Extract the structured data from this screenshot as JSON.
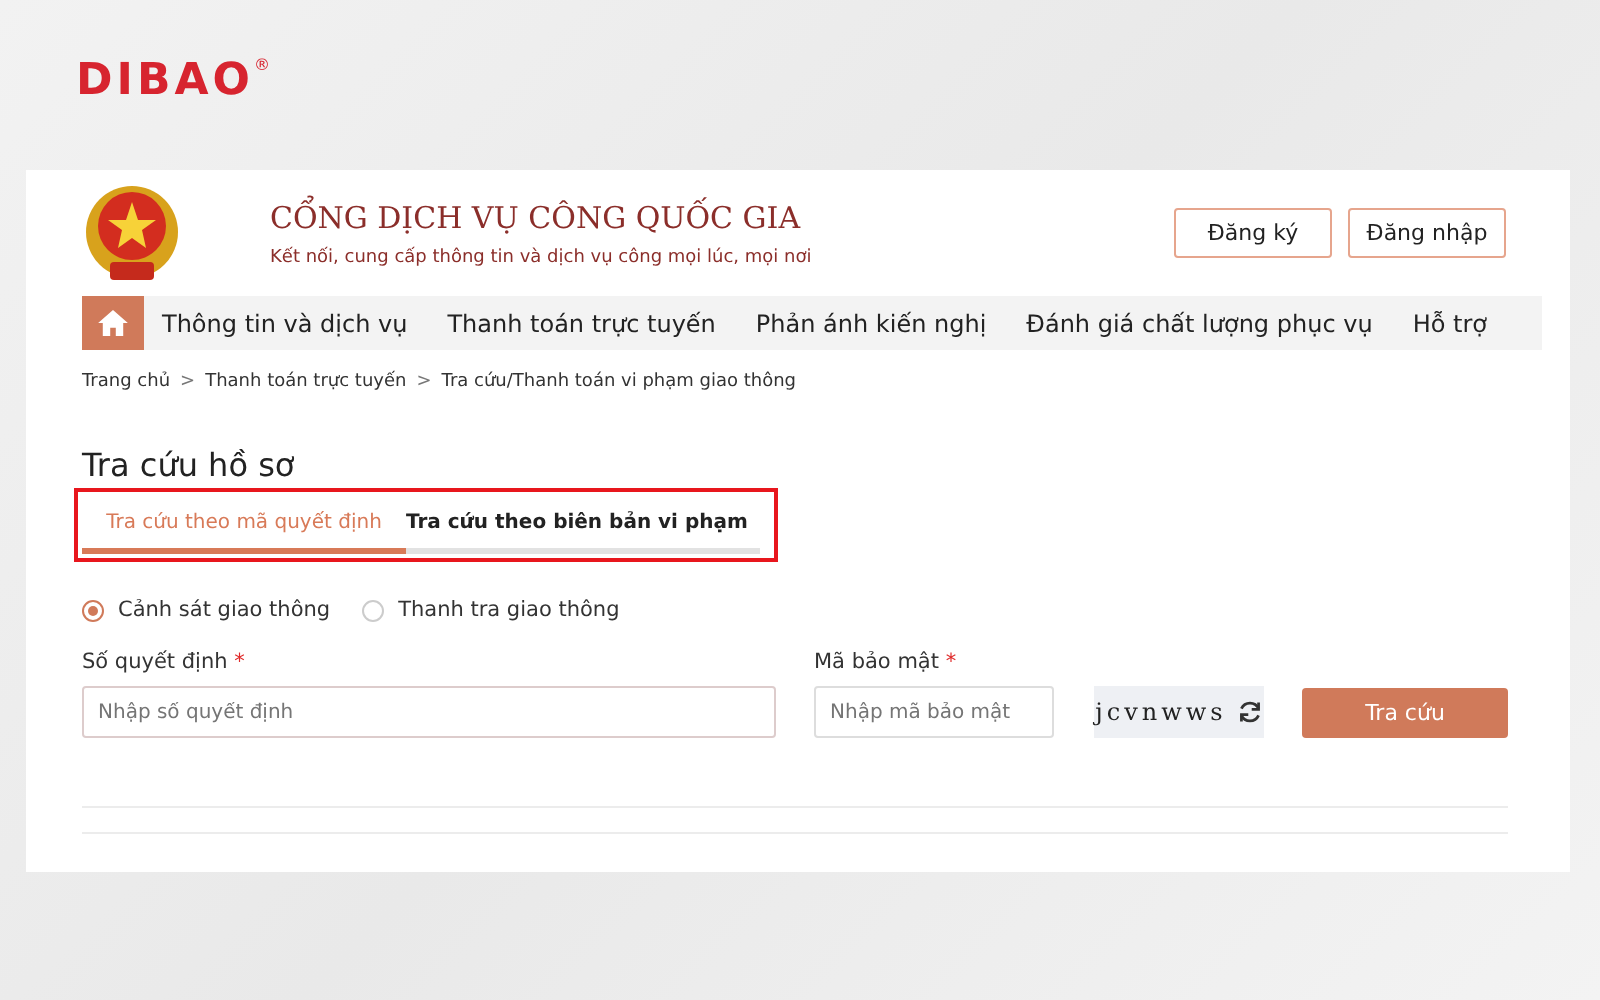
{
  "brand": {
    "logo": "DIBAO",
    "mark": "®"
  },
  "portal": {
    "title": "CỔNG DỊCH VỤ CÔNG QUỐC GIA",
    "tagline": "Kết nối, cung cấp thông tin và dịch vụ công mọi lúc, mọi nơi"
  },
  "auth_buttons": [
    "Đăng ký",
    "Đăng nhập"
  ],
  "nav": [
    "Thông tin và dịch vụ",
    "Thanh toán trực tuyến",
    "Phản ánh kiến nghị",
    "Đánh giá chất lượng phục vụ",
    "Hỗ trợ"
  ],
  "breadcrumb": [
    {
      "label": "Trang chủ"
    },
    {
      "label": "Thanh toán trực tuyến",
      "separator": ">"
    },
    {
      "label": "Tra cứu/Thanh toán vi phạm giao thông",
      "separator": ">"
    }
  ],
  "heading": "Tra cứu hồ sơ",
  "tabs": [
    {
      "label": "Tra cứu theo mã quyết định",
      "selected": true
    },
    {
      "label": "Tra cứu theo biên bản vi phạm",
      "selected": false
    }
  ],
  "agencies": [
    {
      "label": "Cảnh sát giao thông",
      "selected": true
    },
    {
      "label": "Thanh tra giao thông",
      "selected": false
    }
  ],
  "form": {
    "decision": {
      "label": "Số quyết định",
      "required": "*",
      "placeholder": "Nhập số quyết định"
    },
    "security": {
      "label": "Mã bảo mật",
      "required": "*",
      "placeholder": "Nhập mã bảo mật"
    },
    "captcha": "jcvnwws",
    "submit": "Tra cứu"
  }
}
